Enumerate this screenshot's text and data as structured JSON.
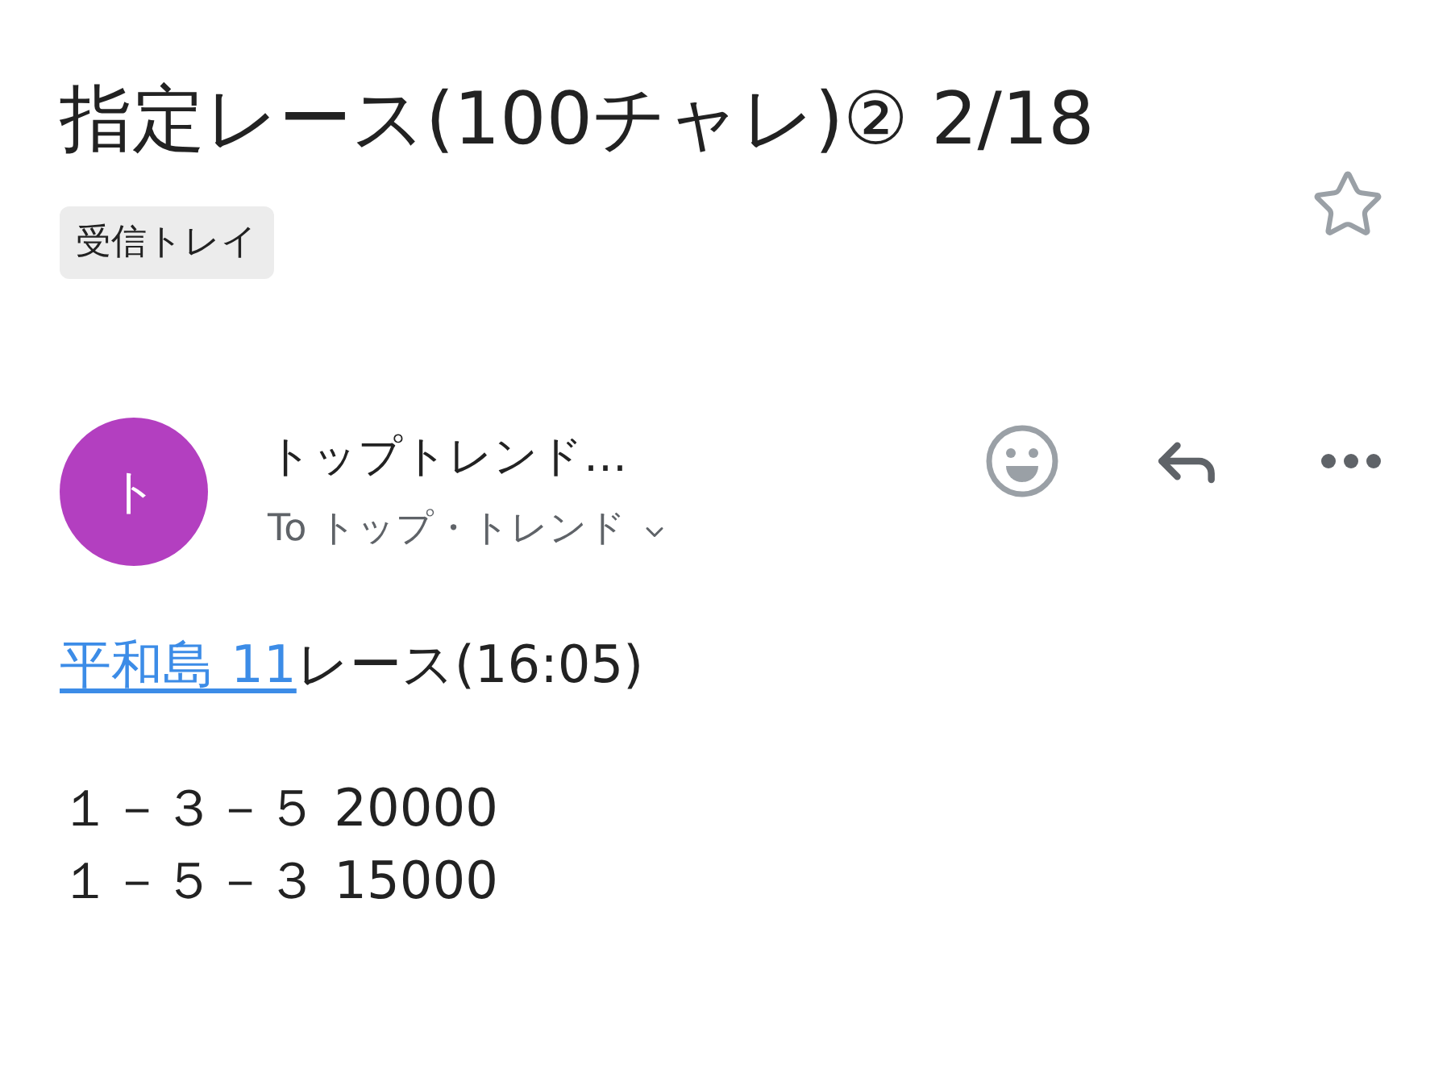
{
  "subject": {
    "title": "指定レース(100チャレ)② 2/18",
    "label": "受信トレイ",
    "starred": false
  },
  "message": {
    "avatar_letter": "ト",
    "sender": "トップトレンド…",
    "recipient": "To トップ・トレンド"
  },
  "body": {
    "link": "平和島 11",
    "heading_rest": "レース(16:05)",
    "lines": [
      "１－３－５ 20000",
      "１－５－３ 15000"
    ]
  }
}
